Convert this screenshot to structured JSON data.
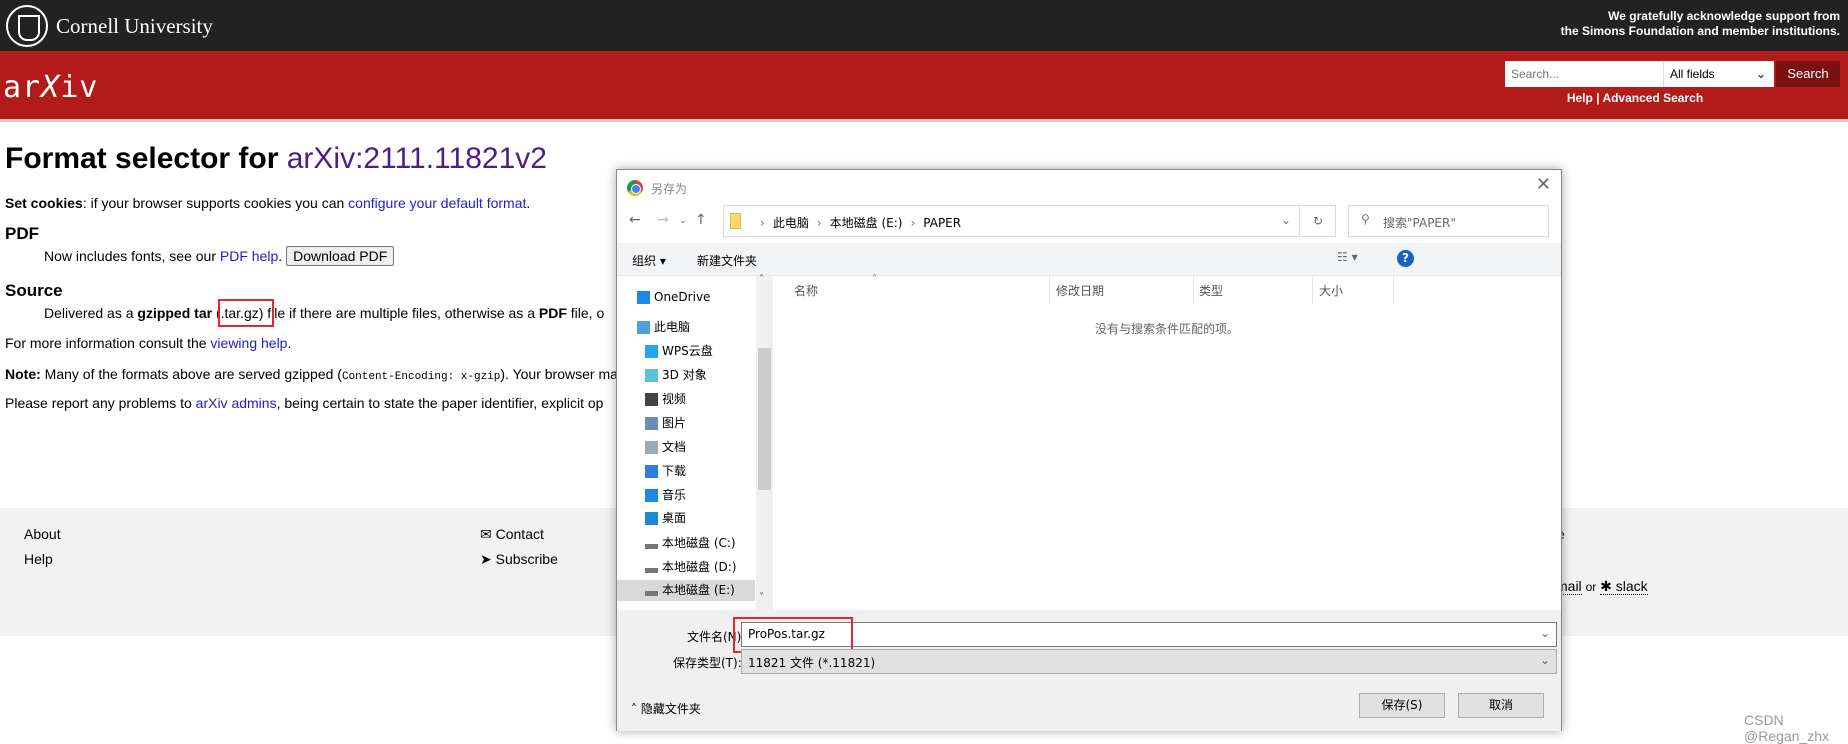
{
  "header": {
    "university": "Cornell University",
    "acknowledgement": [
      "We gratefully acknowledge support from",
      "the Simons Foundation and member institutions."
    ],
    "logo": "arXiv",
    "search_placeholder": "Search...",
    "field_select": "All fields",
    "search_button": "Search",
    "help_link": "Help",
    "separator": "|",
    "advanced_link": "Advanced Search"
  },
  "page": {
    "title_prefix": "Format selector for",
    "paper_id": "arXiv:2111.11821v2",
    "cookies": {
      "bold": "Set cookies",
      "text": ": if your browser supports cookies you can ",
      "link": "configure your default format",
      "end": "."
    },
    "pdf": {
      "heading": "PDF",
      "text": "Now includes fonts, see our ",
      "link": "PDF help",
      "end": ".",
      "button": "Download PDF"
    },
    "source": {
      "heading": "Source",
      "t1": "Delivered as a ",
      "b1": "gzipped tar",
      "ext": "(.tar.gz)",
      "t2": " file if there are multiple files, otherwise as a ",
      "b2": "PDF",
      "t3": " file, o"
    },
    "more": {
      "text": "For more information consult the ",
      "link": "viewing help",
      "end": "."
    },
    "note": {
      "bold": "Note:",
      "text": " Many of the formats above are served gzipped (",
      "code": "Content-Encoding: x-gzip",
      "end": "). Your browser ma"
    },
    "report": {
      "text": "Please report any problems to ",
      "link": "arXiv admins",
      "end": ", being certain to state the paper identifier, explicit op"
    }
  },
  "footer": {
    "about": "About",
    "help": "Help",
    "contact": "Contact",
    "subscribe": "Subscribe",
    "email": "mail",
    "or": "or",
    "slack": "slack",
    "clipped": "e"
  },
  "dialog": {
    "title": "另存为",
    "breadcrumb": [
      "此电脑",
      "本地磁盘 (E:)",
      "PAPER"
    ],
    "search_placeholder": "搜索\"PAPER\"",
    "organize": "组织 ▾",
    "new_folder": "新建文件夹",
    "columns": [
      "名称",
      "修改日期",
      "类型",
      "大小"
    ],
    "empty_message": "没有与搜索条件匹配的项。",
    "nav": [
      {
        "label": "OneDrive",
        "icon": "cloud-icon"
      },
      {
        "label": "此电脑",
        "icon": "computer-icon"
      },
      {
        "label": "WPS云盘",
        "icon": "cloud-drive-icon"
      },
      {
        "label": "3D 对象",
        "icon": "cube-icon"
      },
      {
        "label": "视频",
        "icon": "video-icon"
      },
      {
        "label": "图片",
        "icon": "picture-icon"
      },
      {
        "label": "文档",
        "icon": "document-icon"
      },
      {
        "label": "下载",
        "icon": "download-icon"
      },
      {
        "label": "音乐",
        "icon": "music-icon"
      },
      {
        "label": "桌面",
        "icon": "desktop-icon"
      },
      {
        "label": "本地磁盘 (C:)",
        "icon": "drive-icon"
      },
      {
        "label": "本地磁盘 (D:)",
        "icon": "drive-icon"
      },
      {
        "label": "本地磁盘 (E:)",
        "icon": "drive-icon",
        "selected": true
      }
    ],
    "filename_label": "文件名(N):",
    "filename": "ProPos.tar.gz",
    "filetype_label": "保存类型(T):",
    "filetype": "11821 文件 (*.11821)",
    "hide_folders": "隐藏文件夹",
    "save": "保存(S)",
    "cancel": "取消"
  },
  "watermark": "CSDN @Regan_zhx",
  "colors": {
    "arxiv_red": "#b31b1b",
    "top_bar": "#222222",
    "link": "#2020c8",
    "highlight_box": "#e8262a"
  }
}
